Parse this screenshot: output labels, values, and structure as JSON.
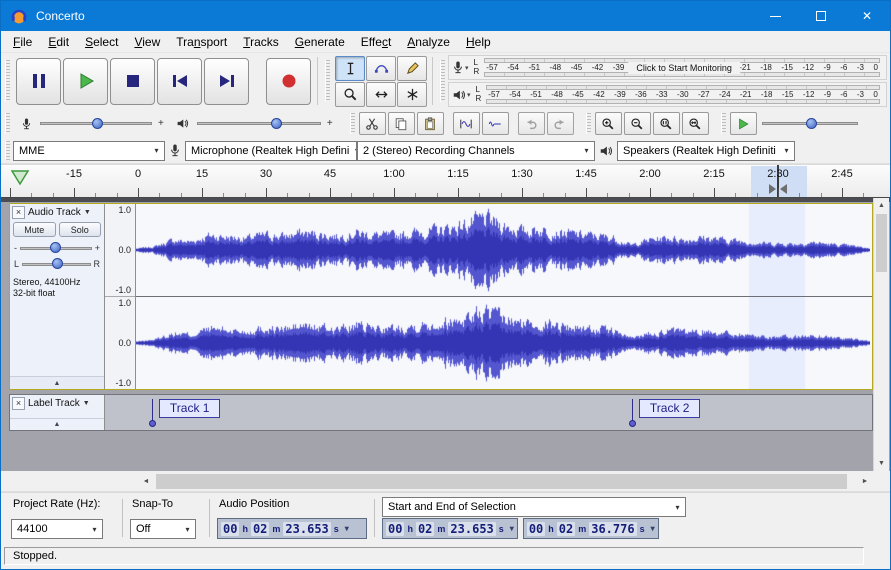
{
  "window": {
    "title": "Concerto"
  },
  "menu": {
    "items": [
      {
        "label": "File",
        "u": 0
      },
      {
        "label": "Edit",
        "u": 0
      },
      {
        "label": "Select",
        "u": 0
      },
      {
        "label": "View",
        "u": 0
      },
      {
        "label": "Transport",
        "u": 3
      },
      {
        "label": "Tracks",
        "u": 0
      },
      {
        "label": "Generate",
        "u": 0
      },
      {
        "label": "Effect",
        "u": 4
      },
      {
        "label": "Analyze",
        "u": 0
      },
      {
        "label": "Help",
        "u": 0
      }
    ]
  },
  "meters": {
    "scale": [
      "-57",
      "-54",
      "-51",
      "-48",
      "-45",
      "-42",
      "-39",
      "-36",
      "-33",
      "-30",
      "-27",
      "-24",
      "-21",
      "-18",
      "-15",
      "-12",
      "-9",
      "-6",
      "-3",
      "0"
    ],
    "channels": [
      "L",
      "R"
    ],
    "record_overlay": "Click to Start Monitoring"
  },
  "device": {
    "host": "MME",
    "input": "Microphone (Realtek High Defini",
    "channels": "2 (Stereo) Recording Channels",
    "output": "Speakers (Realtek High Definiti"
  },
  "timeline": {
    "labels": [
      "-15",
      "0",
      "15",
      "30",
      "45",
      "1:00",
      "1:15",
      "1:30",
      "1:45",
      "2:00",
      "2:15",
      "2:30",
      "2:45"
    ],
    "label_times": [
      -15,
      0,
      15,
      30,
      45,
      60,
      75,
      90,
      105,
      120,
      135,
      150,
      165
    ],
    "playhead_s": 150
  },
  "selection": {
    "start_s": 143.653,
    "end_s": 156.776
  },
  "track": {
    "close": "×",
    "title": "Audio Track",
    "mute": "Mute",
    "solo": "Solo",
    "gain_min": "-",
    "gain_max": "+",
    "pan_left": "L",
    "pan_right": "R",
    "info1": "Stereo, 44100Hz",
    "info2": "32-bit float",
    "vruler": [
      "1.0",
      "0.0",
      "-1.0"
    ]
  },
  "label_track": {
    "close": "×",
    "title": "Label Track",
    "labels": [
      {
        "text": "Track 1",
        "time_s": 3.5
      },
      {
        "text": "Track 2",
        "time_s": 116
      }
    ]
  },
  "selection_toolbar": {
    "project_rate_label": "Project Rate (Hz):",
    "project_rate": "44100",
    "snap_label": "Snap-To",
    "snap": "Off",
    "audio_position_label": "Audio Position",
    "mode": "Start and End of Selection",
    "units": {
      "h": "h",
      "m": "m",
      "s": "s"
    },
    "audio_position": {
      "h": "00",
      "m": "02",
      "s": "23.653"
    },
    "sel_start": {
      "h": "00",
      "m": "02",
      "s": "23.653"
    },
    "sel_end": {
      "h": "00",
      "m": "02",
      "s": "36.776"
    }
  },
  "status": {
    "text": "Stopped."
  },
  "icons": {
    "chevron_down": "▾",
    "caret_down": "▼",
    "caret_up": "▲",
    "close_small": "×",
    "window_close": "✕",
    "plus": "+",
    "arrow_up": "▲",
    "arrow_down": "▼",
    "arrow_left": "◄",
    "arrow_right": "►"
  },
  "waveform": {
    "envelope": [
      0.04,
      0.1,
      0.28,
      0.24,
      0.42,
      0.38,
      0.34,
      0.44,
      0.4,
      0.5,
      0.46,
      0.4,
      0.5,
      0.44,
      0.42,
      0.5,
      0.55,
      0.62,
      0.75,
      0.92,
      0.72,
      0.56,
      0.6,
      0.52,
      0.46,
      0.42,
      0.36,
      0.14,
      0.3,
      0.36,
      0.3,
      0.36,
      0.3,
      0.26,
      0.2,
      0.18,
      0.18,
      0.22,
      0.16,
      0.12,
      0.05
    ]
  },
  "colors": {
    "titlebar": "#0b7ad7",
    "waveform": "#5456cf",
    "waveform_dark": "#3435b4",
    "track_bg": "#f7f8fb",
    "selection_bg": "#e7edfc",
    "play_green": "#4cb84c",
    "record_red": "#d23030",
    "navy": "#26267e"
  }
}
